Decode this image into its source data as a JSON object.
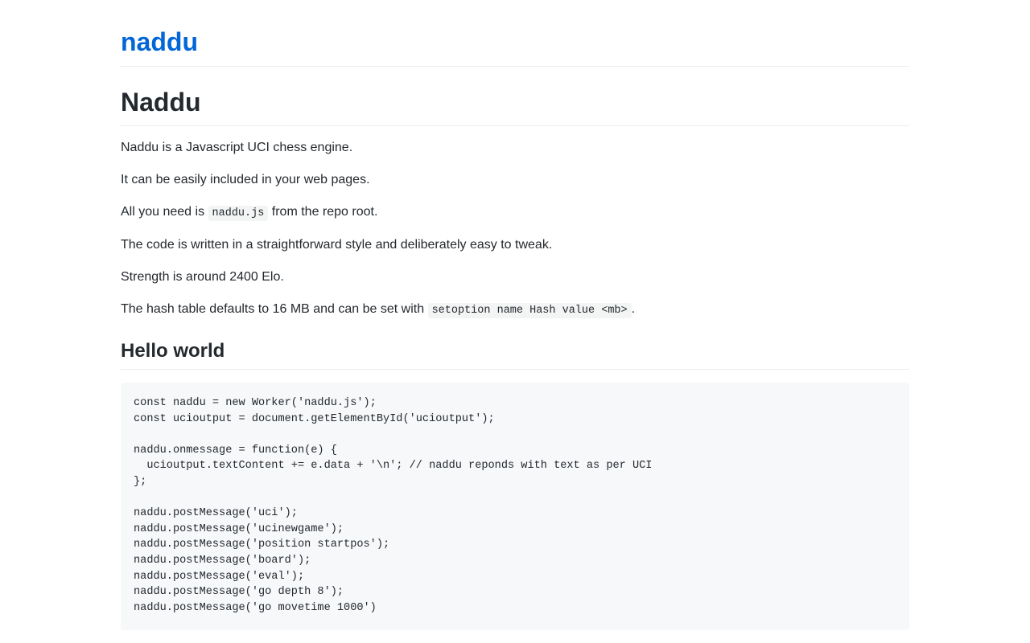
{
  "header": {
    "site_title": "naddu"
  },
  "main": {
    "title": "Naddu",
    "paragraphs": {
      "p1": "Naddu is a Javascript UCI chess engine.",
      "p2": "It can be easily included in your web pages.",
      "p3_before": "All you need is ",
      "p3_code": "naddu.js",
      "p3_after": " from the repo root.",
      "p4": "The code is written in a straightforward style and deliberately easy to tweak.",
      "p5": "Strength is around 2400 Elo.",
      "p6_before": "The hash table defaults to 16 MB and can be set with ",
      "p6_code": "setoption name Hash value <mb>",
      "p6_after": "."
    },
    "section_hello": {
      "heading": "Hello world",
      "code": "const naddu = new Worker('naddu.js');\nconst ucioutput = document.getElementById('ucioutput');\n\nnaddu.onmessage = function(e) {\n  ucioutput.textContent += e.data + '\\n'; // naddu reponds with text as per UCI\n};\n\nnaddu.postMessage('uci');\nnaddu.postMessage('ucinewgame');\nnaddu.postMessage('position startpos');\nnaddu.postMessage('board');\nnaddu.postMessage('eval');\nnaddu.postMessage('go depth 8');\nnaddu.postMessage('go movetime 1000')"
    }
  },
  "colors": {
    "link": "#0366d6",
    "text": "#24292e",
    "code_bg": "#f6f8fa",
    "rule": "#eaecef"
  }
}
